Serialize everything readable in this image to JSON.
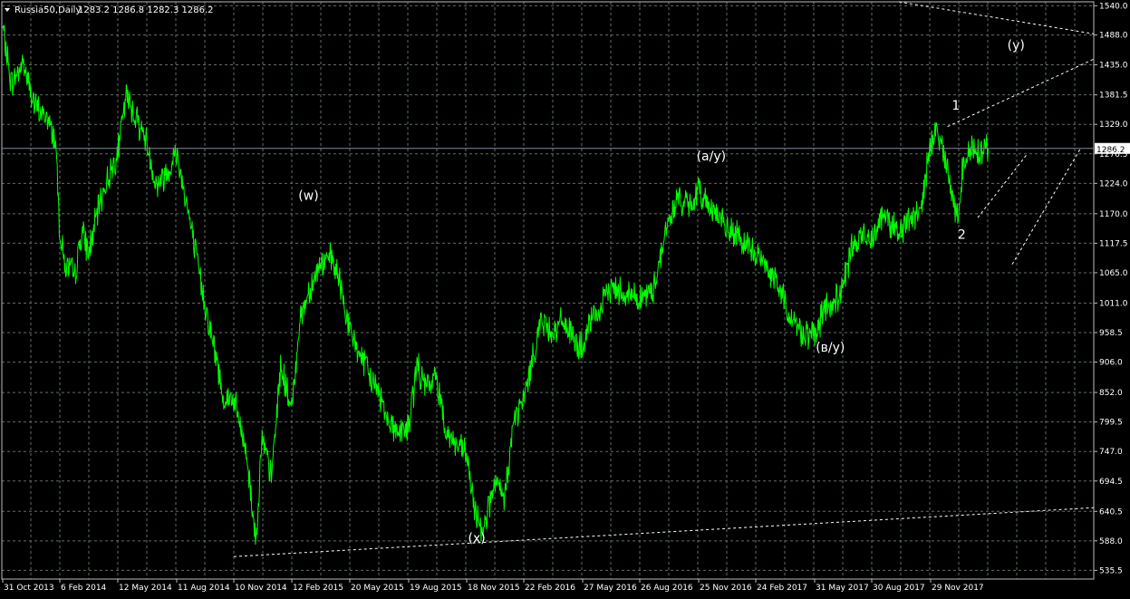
{
  "header": {
    "symbol_label": "Russia50,Daily",
    "ohlc": "1283.2 1286.8 1282.3 1286.2"
  },
  "colors": {
    "background": "#000000",
    "grid": "#5f6f5f",
    "price_line": "#00ff00",
    "axis_text": "#ffffff",
    "annotation": "#ffffff",
    "current_price_line": "#7f8a9a"
  },
  "chart_data": {
    "type": "line",
    "y_scale": "linear",
    "ylim": [
      520.0,
      1547.0
    ],
    "grid": true,
    "y_tick_labels": [
      "1540.0",
      "1488.0",
      "1435.0",
      "1381.5",
      "1329.0",
      "1276.5",
      "1224.0",
      "1170.0",
      "1117.5",
      "1065.0",
      "1011.0",
      "958.5",
      "906.0",
      "852.0",
      "799.5",
      "747.0",
      "694.5",
      "640.5",
      "588.0",
      "535.5"
    ],
    "x_tick_labels": [
      "31 Oct 2013",
      "6 Feb 2014",
      "12 May 2014",
      "11 Aug 2014",
      "10 Nov 2014",
      "12 Feb 2015",
      "20 May 2015",
      "19 Aug 2015",
      "18 Nov 2015",
      "22 Feb 2016",
      "27 May 2016",
      "26 Aug 2016",
      "25 Nov 2016",
      "24 Feb 2017",
      "31 May 2017",
      "30 Aug 2017",
      "29 Nov 2017"
    ],
    "current_price": 1286.2,
    "series": [
      {
        "x": [
          "31 Oct 2013",
          "15 Nov 2013",
          "5 Dec 2013",
          "25 Dec 2013",
          "15 Jan 2014",
          "30 Jan 2014",
          "6 Feb 2014",
          "14 Feb 2014",
          "3 Mar 2014",
          "14 Mar 2014",
          "25 Mar 2014",
          "15 Apr 2014",
          "12 May 2014",
          "25 May 2014",
          "10 Jun 2014",
          "25 Jun 2014",
          "10 Jul 2014",
          "25 Jul 2014",
          "11 Aug 2014",
          "25 Aug 2014",
          "10 Sep 2014",
          "25 Sep 2014",
          "15 Oct 2014",
          "25 Oct 2014",
          "10 Nov 2014",
          "1 Dec 2014",
          "16 Dec 2014",
          "25 Dec 2014",
          "10 Jan 2015",
          "25 Jan 2015",
          "12 Feb 2015",
          "25 Feb 2015",
          "15 Mar 2015",
          "1 Apr 2015",
          "20 Apr 2015",
          "5 May 2015",
          "20 May 2015",
          "5 Jun 2015",
          "20 Jun 2015",
          "5 Jul 2015",
          "20 Jul 2015",
          "5 Aug 2015",
          "19 Aug 2015",
          "1 Sep 2015",
          "15 Sep 2015",
          "1 Oct 2015",
          "18 Oct 2015",
          "1 Nov 2015",
          "18 Nov 2015",
          "1 Dec 2015",
          "15 Dec 2015",
          "5 Jan 2016",
          "20 Jan 2016",
          "5 Feb 2016",
          "22 Feb 2016",
          "5 Mar 2016",
          "20 Mar 2016",
          "10 Apr 2016",
          "27 Apr 2016",
          "15 May 2016",
          "27 May 2016",
          "10 Jun 2016",
          "25 Jun 2016",
          "10 Jul 2016",
          "26 Aug 2016",
          "15 Sep 2016",
          "5 Oct 2016",
          "25 Oct 2016",
          "10 Nov 2016",
          "25 Nov 2016",
          "10 Dec 2016",
          "25 Dec 2016",
          "10 Jan 2017",
          "25 Jan 2017",
          "10 Feb 2017",
          "24 Feb 2017",
          "10 Mar 2017",
          "25 Mar 2017",
          "10 Apr 2017",
          "25 Apr 2017",
          "10 May 2017",
          "31 May 2017",
          "15 Jun 2017",
          "30 Jun 2017",
          "15 Jul 2017",
          "30 Jul 2017",
          "15 Aug 2017",
          "30 Aug 2017",
          "15 Sep 2017",
          "30 Sep 2017",
          "15 Oct 2017",
          "30 Oct 2017",
          "15 Nov 2017",
          "29 Nov 2017",
          "10 Dec 2017",
          "20 Dec 2017",
          "1 Jan 2018",
          "10 Jan 2018",
          "15 Jan 2018",
          "22 Jan 2018",
          "29 Jan 2018",
          "5 Feb 2018",
          "12 Feb 2018",
          "19 Feb 2018",
          "26 Feb 2018"
        ],
        "values": [
          1500,
          1400,
          1440,
          1360,
          1340,
          1300,
          1140,
          1080,
          1060,
          1140,
          1100,
          1200,
          1280,
          1380,
          1340,
          1300,
          1220,
          1240,
          1280,
          1200,
          1100,
          1010,
          900,
          840,
          840,
          740,
          585,
          770,
          700,
          900,
          820,
          980,
          1040,
          1080,
          1090,
          1040,
          960,
          920,
          880,
          850,
          800,
          780,
          790,
          900,
          860,
          880,
          780,
          760,
          740,
          640,
          610,
          690,
          660,
          800,
          840,
          900,
          980,
          960,
          980,
          940,
          930,
          980,
          1000,
          1040,
          1020,
          1030,
          1140,
          1200,
          1180,
          1210,
          1190,
          1170,
          1140,
          1130,
          1110,
          1100,
          1080,
          1060,
          1020,
          980,
          960,
          950,
          1000,
          1010,
          1040,
          1110,
          1130,
          1130,
          1170,
          1150,
          1140,
          1160,
          1180,
          1300,
          1320,
          1280,
          1200,
          1160,
          1230,
          1270,
          1286.2,
          1290,
          1280,
          1286.2,
          1286.2
        ]
      }
    ],
    "annotations": [
      {
        "label": "(w)",
        "x": "12 Mar 2015",
        "y": 1195
      },
      {
        "label": "(x)",
        "x": "5 Dec 2015",
        "y": 585
      },
      {
        "label": "(a/y)",
        "x": "15 Dec 2016",
        "y": 1265
      },
      {
        "label": "(в/у)",
        "x": "25 Jun 2017",
        "y": 925
      },
      {
        "label": "(y)",
        "x": "10 Apr 2018",
        "y": 1462
      },
      {
        "label": "1",
        "x": "7 Jan 2018",
        "y": 1355
      },
      {
        "label": "2",
        "x": "16 Jan 2018",
        "y": 1125
      }
    ]
  }
}
